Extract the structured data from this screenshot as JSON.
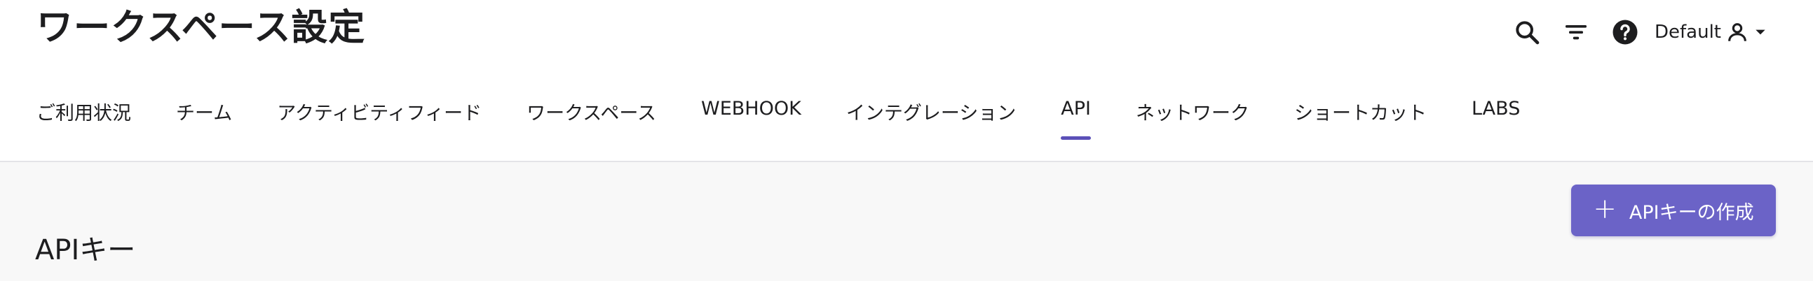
{
  "page": {
    "title": "ワークスペース設定"
  },
  "toolbar": {
    "icons": [
      "search-icon",
      "filter-icon",
      "help-icon"
    ],
    "account_label": "Default"
  },
  "tabs": [
    {
      "label": "ご利用状況",
      "active": false
    },
    {
      "label": "チーム",
      "active": false
    },
    {
      "label": "アクティビティフィード",
      "active": false
    },
    {
      "label": "ワークスペース",
      "active": false
    },
    {
      "label": "WEBHOOK",
      "active": false
    },
    {
      "label": "インテグレーション",
      "active": false
    },
    {
      "label": "API",
      "active": true
    },
    {
      "label": "ネットワーク",
      "active": false
    },
    {
      "label": "ショートカット",
      "active": false
    },
    {
      "label": "LABS",
      "active": false
    }
  ],
  "main": {
    "create_button_label": "APIキーの作成",
    "section_title": "APIキー"
  },
  "colors": {
    "accent": "#5b50b8",
    "button": "#6b63c7",
    "page_bg": "#f8f8f8"
  }
}
